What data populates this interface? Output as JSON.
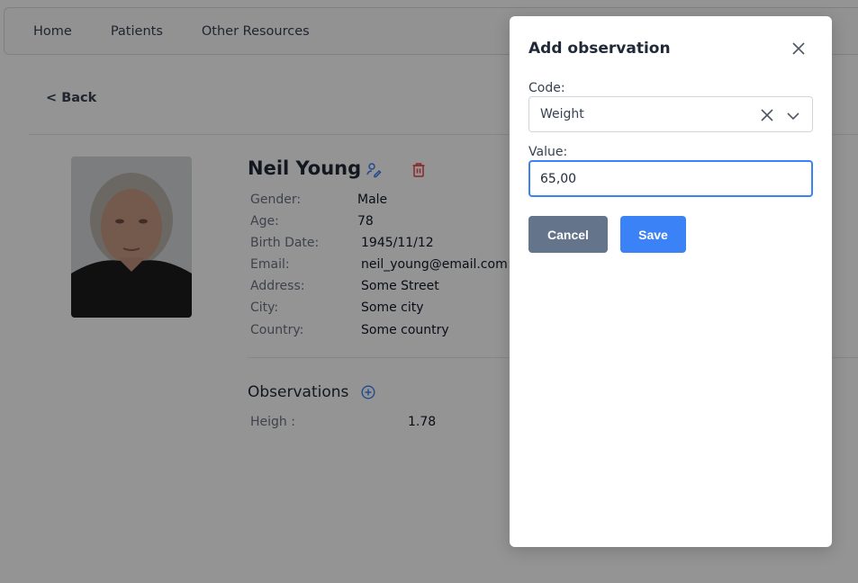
{
  "nav": {
    "items": [
      "Home",
      "Patients",
      "Other Resources"
    ]
  },
  "back_label": "< Back",
  "patient": {
    "name": "Neil Young",
    "fields": [
      {
        "label": "Gender:",
        "value": "Male"
      },
      {
        "label": "Age:",
        "value": "78"
      },
      {
        "label": "Birth Date:",
        "value": "1945/11/12"
      },
      {
        "label": "Email:",
        "value": "neil_young@email.com"
      },
      {
        "label": "Address:",
        "value": "Some Street"
      },
      {
        "label": "City:",
        "value": "Some city"
      },
      {
        "label": "Country:",
        "value": "Some country"
      }
    ]
  },
  "observations": {
    "title": "Observations",
    "items": [
      {
        "label": "Heigh :",
        "value": "1.78"
      }
    ]
  },
  "modal": {
    "title": "Add observation",
    "code_label": "Code:",
    "code_value": "Weight",
    "value_label": "Value:",
    "value_value": "65,00",
    "cancel_label": "Cancel",
    "save_label": "Save"
  },
  "icons": {
    "edit": "user-edit-icon",
    "delete": "trash-icon",
    "add": "plus-circle-icon",
    "close": "close-icon",
    "clear": "x-icon",
    "chevron": "chevron-down-icon"
  },
  "colors": {
    "primary": "#3b82f6",
    "secondary": "#64748b",
    "danger": "#ef4444"
  }
}
